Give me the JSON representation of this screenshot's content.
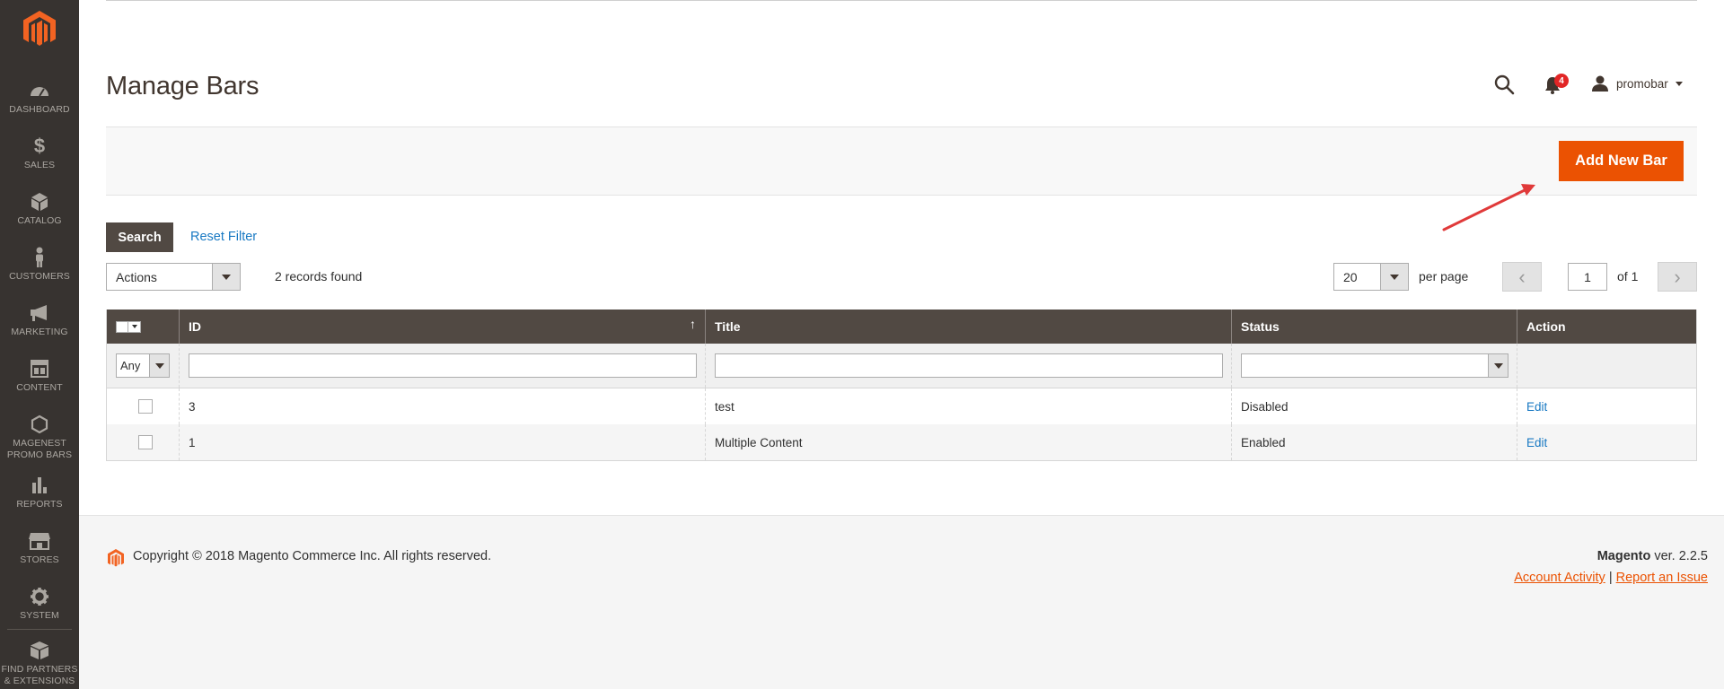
{
  "sidebar": {
    "items": [
      {
        "label": "DASHBOARD",
        "icon": "dashboard-icon"
      },
      {
        "label": "SALES",
        "icon": "dollar-icon"
      },
      {
        "label": "CATALOG",
        "icon": "cube-icon"
      },
      {
        "label": "CUSTOMERS",
        "icon": "person-icon"
      },
      {
        "label": "MARKETING",
        "icon": "megaphone-icon"
      },
      {
        "label": "CONTENT",
        "icon": "layout-icon"
      },
      {
        "label": "MAGENEST\nPROMO BARS",
        "icon": "hexagon-icon"
      },
      {
        "label": "REPORTS",
        "icon": "bar-chart-icon"
      },
      {
        "label": "STORES",
        "icon": "store-icon"
      },
      {
        "label": "SYSTEM",
        "icon": "gear-icon"
      },
      {
        "label": "FIND PARTNERS\n& EXTENSIONS",
        "icon": "box-icon"
      }
    ]
  },
  "header": {
    "title": "Manage Bars",
    "notification_count": "4",
    "username": "promobar"
  },
  "action_bar": {
    "add_new_label": "Add New Bar"
  },
  "toolbar": {
    "search_label": "Search",
    "reset_filter_label": "Reset Filter",
    "actions_selected": "Actions",
    "records_found": "2 records found",
    "per_page_value": "20",
    "per_page_label": "per page",
    "current_page": "1",
    "of_pages": "of 1"
  },
  "grid": {
    "columns": [
      "ID",
      "Title",
      "Status",
      "Action"
    ],
    "filter_any": "Any",
    "rows": [
      {
        "id": "3",
        "title": "test",
        "status": "Disabled",
        "action": "Edit"
      },
      {
        "id": "1",
        "title": "Multiple Content",
        "status": "Enabled",
        "action": "Edit"
      }
    ]
  },
  "footer": {
    "copyright": "Copyright © 2018 Magento Commerce Inc. All rights reserved.",
    "brand": "Magento",
    "version": " ver. 2.2.5",
    "link_account": "Account Activity",
    "separator": "|",
    "link_report": "Report an Issue"
  },
  "colors": {
    "sidebar_bg": "#373330",
    "accent_orange": "#eb5202",
    "grid_header": "#514943",
    "link_blue": "#1979c3",
    "badge_red": "#e22626"
  }
}
